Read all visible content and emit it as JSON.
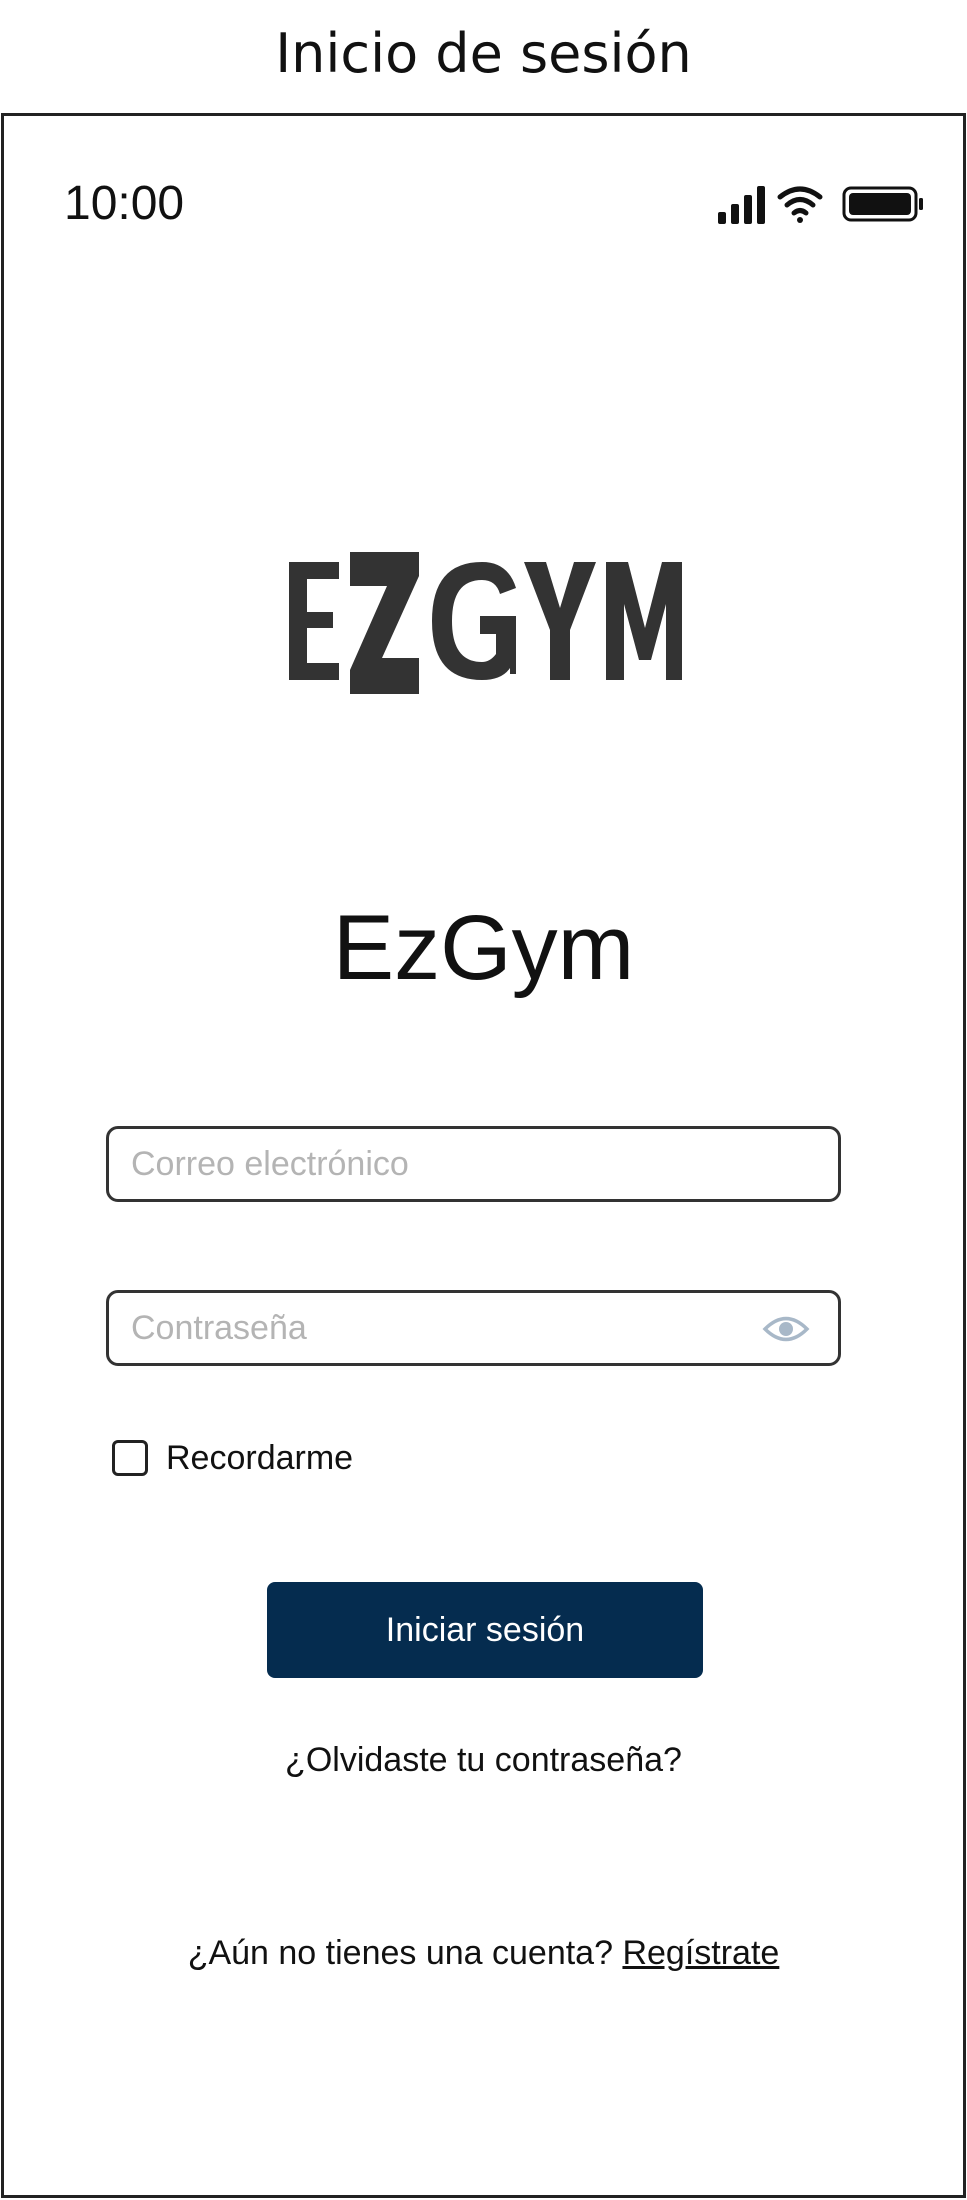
{
  "page": {
    "title": "Inicio de sesión"
  },
  "status_bar": {
    "time": "10:00",
    "icons": [
      "signal-icon",
      "wifi-icon",
      "battery-icon"
    ]
  },
  "brand": {
    "logo_text": "EZGYM",
    "app_name": "EzGym"
  },
  "form": {
    "email": {
      "placeholder": "Correo electrónico",
      "value": ""
    },
    "password": {
      "placeholder": "Contraseña",
      "value": "",
      "toggle_icon": "eye-icon"
    },
    "remember": {
      "label": "Recordarme",
      "checked": false
    },
    "submit_label": "Iniciar sesión",
    "forgot_label": "¿Olvidaste tu contraseña?"
  },
  "signup": {
    "prompt": "¿Aún no tienes una cuenta?",
    "link_label": "Regístrate"
  },
  "colors": {
    "primary_button": "#052c4f",
    "placeholder": "#b4b4b4",
    "logo": "#333333",
    "eye_icon": "#a8b8c8"
  }
}
